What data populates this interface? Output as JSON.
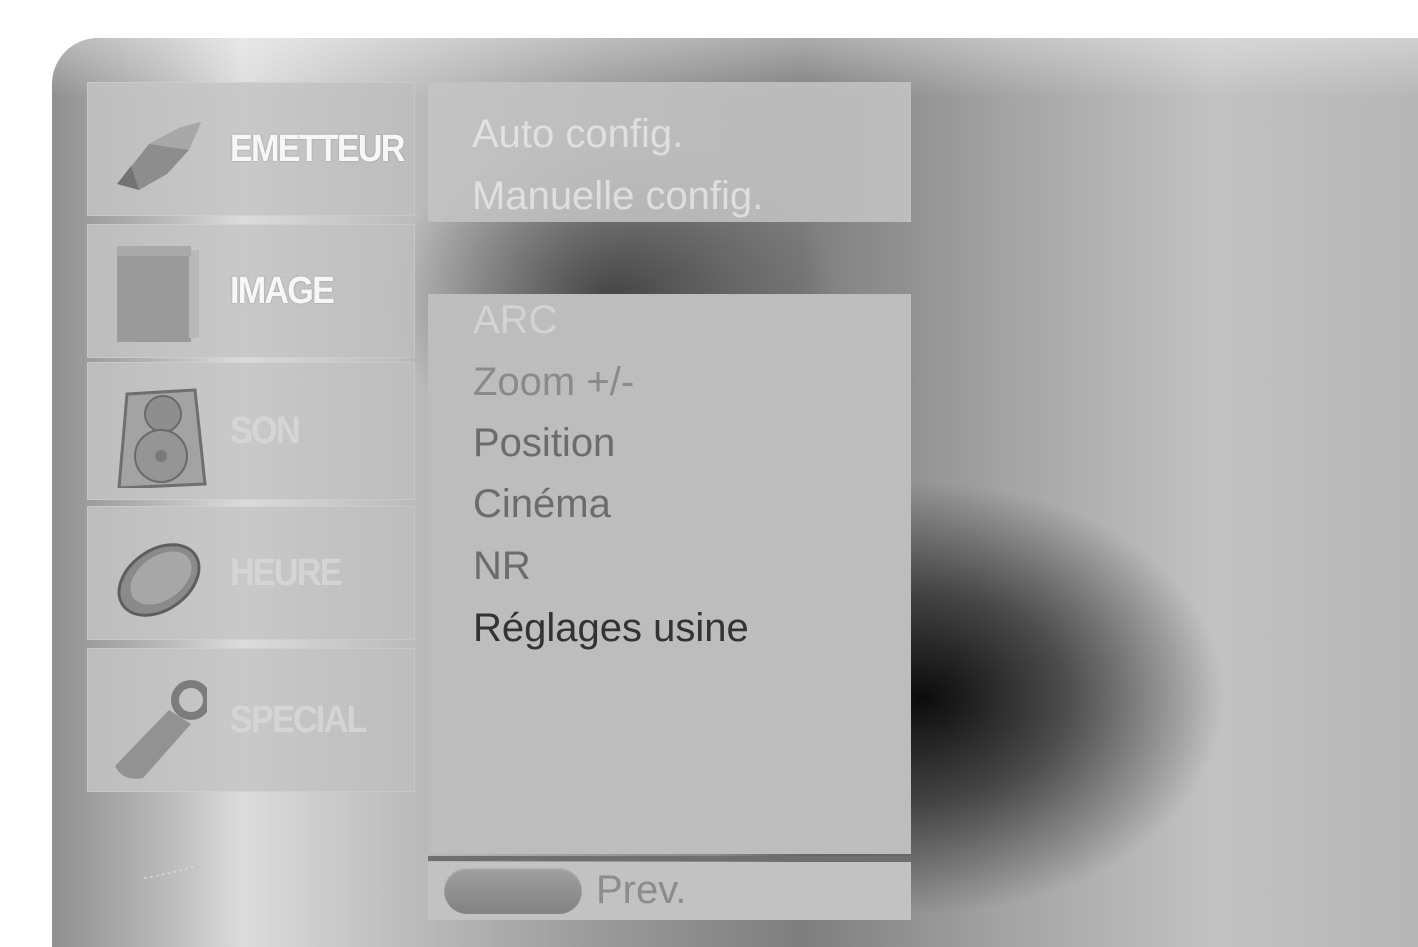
{
  "menu": {
    "categories": [
      {
        "label": "EMETTEUR",
        "icon": "satellite-dish-icon",
        "state": "active"
      },
      {
        "label": "IMAGE",
        "icon": "picture-screen-icon",
        "state": "active"
      },
      {
        "label": "SON",
        "icon": "speaker-icon",
        "state": "dim"
      },
      {
        "label": "HEURE",
        "icon": "clock-icon",
        "state": "dim"
      },
      {
        "label": "SPECIAL",
        "icon": "key-tag-icon",
        "state": "dim"
      }
    ]
  },
  "channel_submenu": {
    "items": [
      "Auto config.",
      "Manuelle config."
    ]
  },
  "image_submenu": {
    "items": [
      "ARC",
      "Zoom +/-",
      "Position",
      "Cinéma",
      "NR",
      "Réglages usine"
    ]
  },
  "footer": {
    "prev_label": "Prev."
  }
}
